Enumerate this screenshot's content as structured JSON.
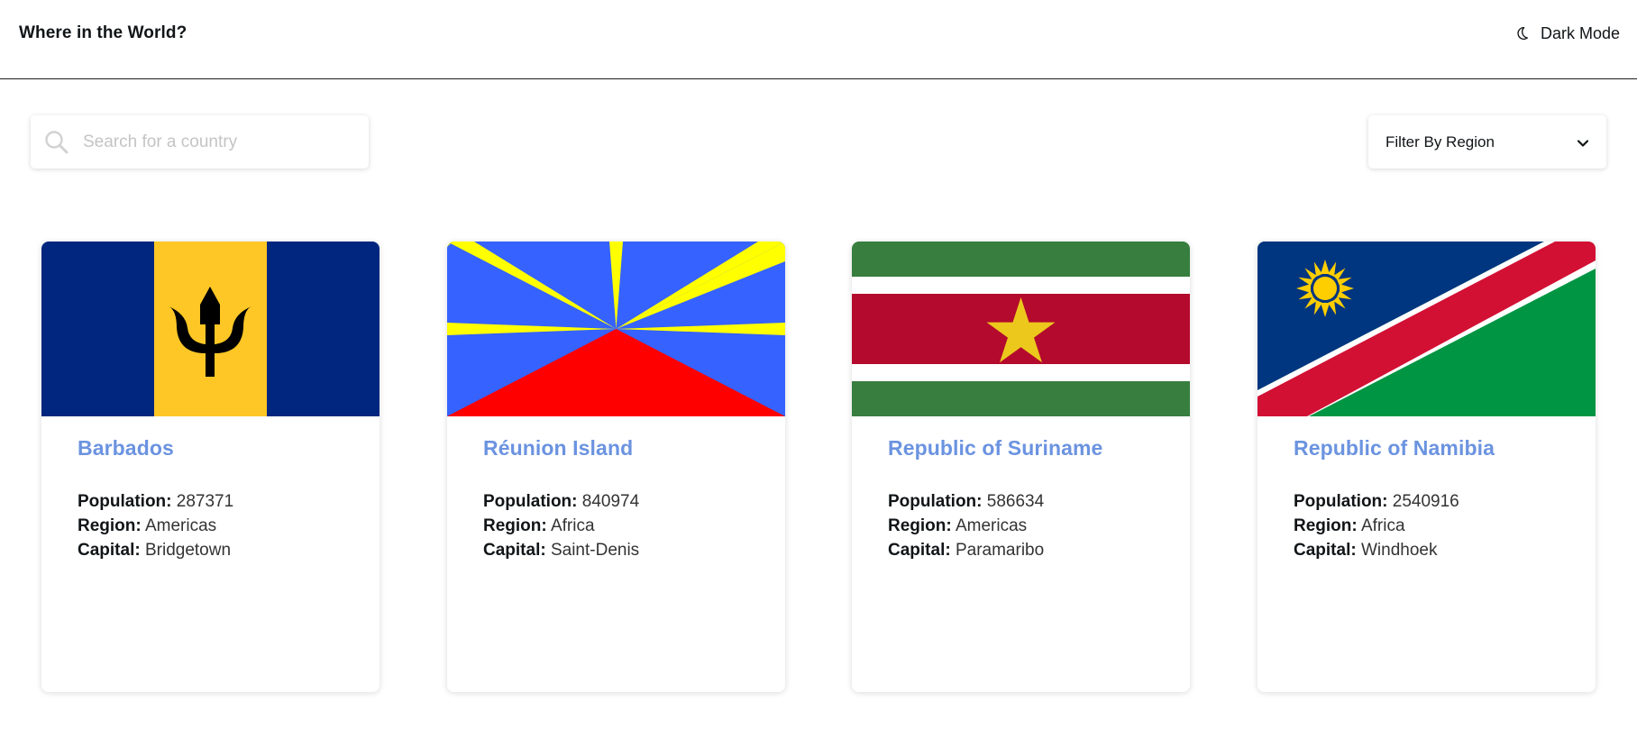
{
  "header": {
    "title": "Where in the World?",
    "theme_toggle_label": "Dark Mode",
    "theme_icon": "moon-icon"
  },
  "search": {
    "placeholder": "Search for a country",
    "value": "",
    "icon": "search-icon"
  },
  "filter": {
    "label": "Filter By Region",
    "icon": "chevron-down-icon"
  },
  "labels": {
    "population": "Population:",
    "region": "Region:",
    "capital": "Capital:"
  },
  "colors": {
    "country_name": "#6b93e0"
  },
  "countries": [
    {
      "name": "Barbados",
      "population": "287371",
      "region": "Americas",
      "capital": "Bridgetown",
      "flag": "barbados-flag"
    },
    {
      "name": "Réunion Island",
      "population": "840974",
      "region": "Africa",
      "capital": "Saint-Denis",
      "flag": "reunion-flag"
    },
    {
      "name": "Republic of Suriname",
      "population": "586634",
      "region": "Americas",
      "capital": "Paramaribo",
      "flag": "suriname-flag"
    },
    {
      "name": "Republic of Namibia",
      "population": "2540916",
      "region": "Africa",
      "capital": "Windhoek",
      "flag": "namibia-flag"
    }
  ]
}
